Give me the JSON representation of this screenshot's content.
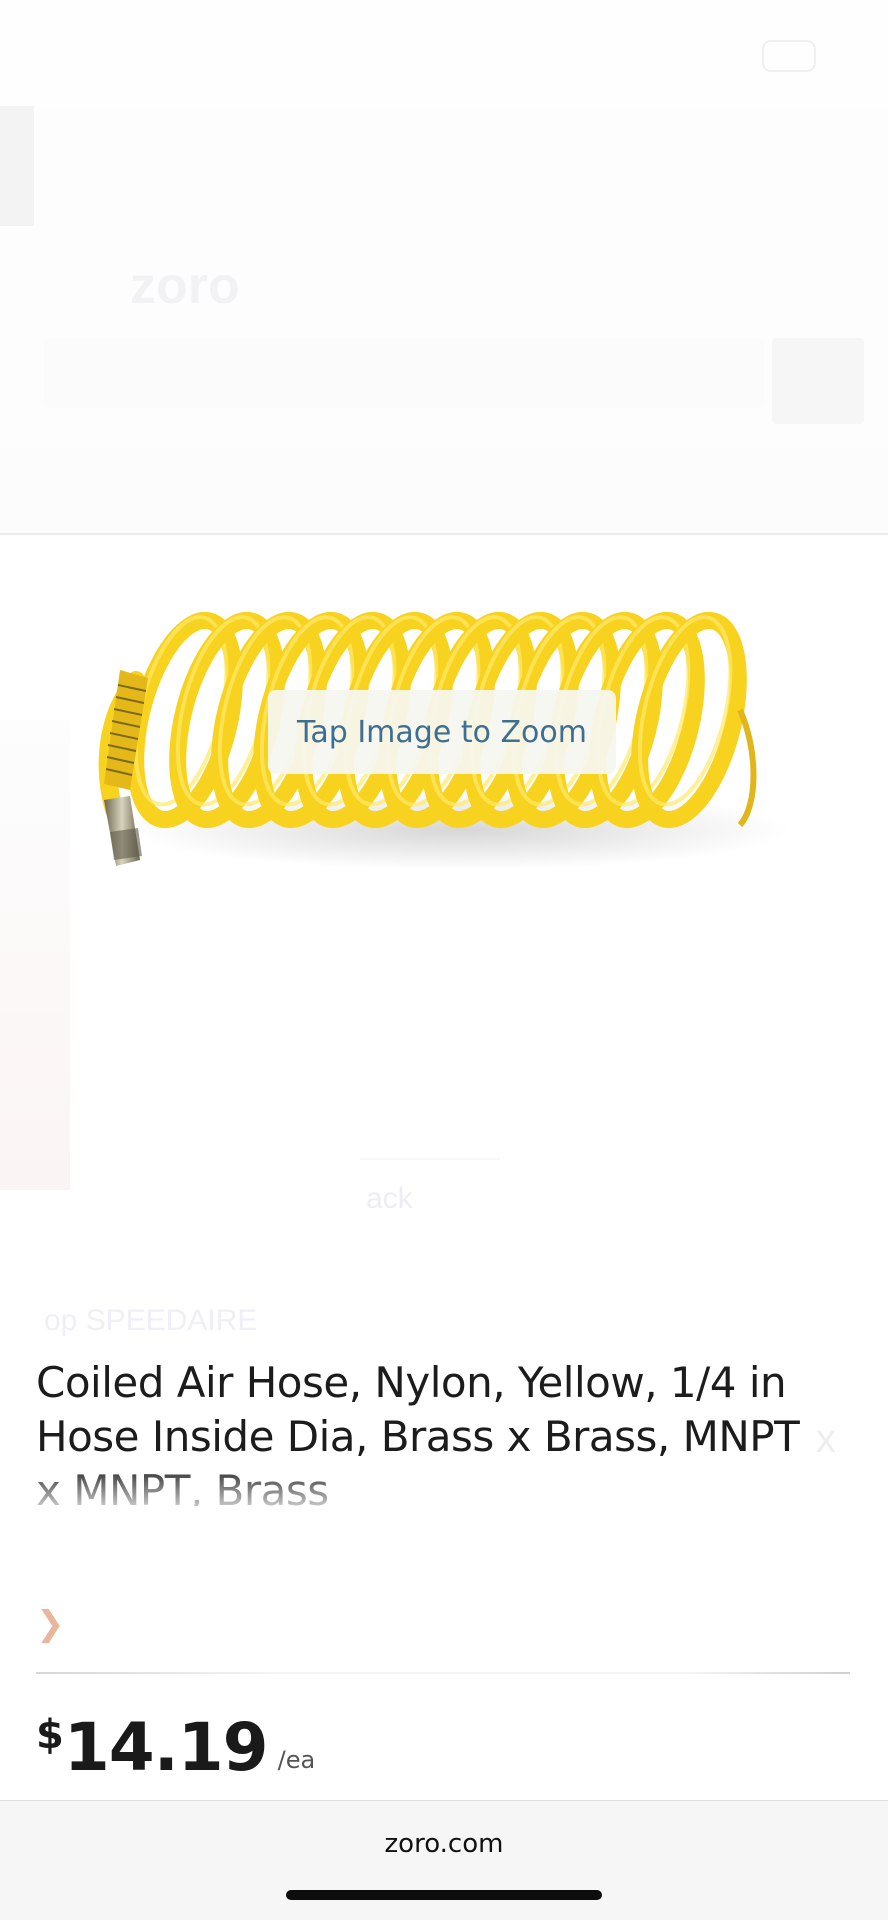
{
  "background": {
    "logo_text": "zoro",
    "back_link": "ack",
    "shop_link": "op SPEEDAIRE",
    "title_overflow": "x"
  },
  "image_overlay": {
    "zoom_hint": "Tap Image to Zoom"
  },
  "product": {
    "title": "Coiled Air Hose, Nylon, Yellow, 1/4 in Hose Inside Dia, Brass x Brass, MNPT x MNPT, Brass",
    "price_currency": "$",
    "price_amount": "14.19",
    "price_unit": "/ea",
    "hose_color": "#F7D21E"
  },
  "browser": {
    "url": "zoro.com"
  },
  "colors": {
    "zoom_text": "#3F6F90",
    "title_text": "#1C1C1C"
  }
}
